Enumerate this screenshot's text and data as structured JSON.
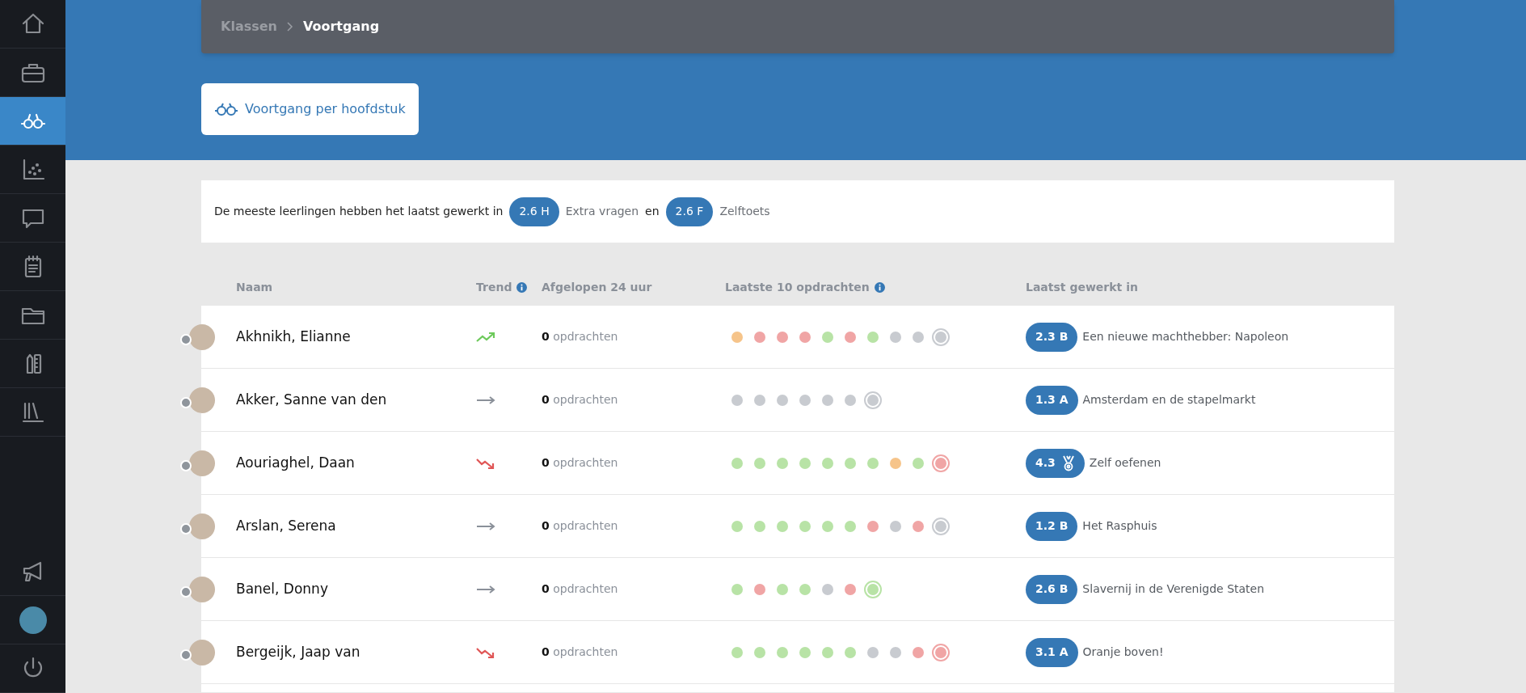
{
  "sidebar": {
    "items": [
      {
        "kind": "home",
        "selected": false
      },
      {
        "kind": "briefcase",
        "selected": false
      },
      {
        "kind": "glasses",
        "selected": true
      },
      {
        "kind": "scatter",
        "selected": false
      },
      {
        "kind": "chat",
        "selected": false
      },
      {
        "kind": "notepad",
        "selected": false
      },
      {
        "kind": "folder",
        "selected": false
      },
      {
        "kind": "tools",
        "selected": false
      },
      {
        "kind": "library",
        "selected": false
      }
    ],
    "bottom_items": [
      {
        "kind": "megaphone"
      },
      {
        "kind": "avatar"
      },
      {
        "kind": "power"
      }
    ]
  },
  "breadcrumb": [
    "Klassen",
    "Voortgang"
  ],
  "action_button": "Voortgang per hoofdstuk",
  "summary": {
    "lead": "De meeste leerlingen hebben het laatst gewerkt in",
    "badge_1": "2.6 H",
    "label_1": "Extra vragen",
    "joiner": "en",
    "badge_2": "2.6 F",
    "label_2": "Zelftoets"
  },
  "table": {
    "columns": [
      {
        "label": "Naam",
        "info": false
      },
      {
        "label": "Trend",
        "info": true
      },
      {
        "label": "Afgelopen 24 uur",
        "info": false
      },
      {
        "label": "Laatste 10 opdrachten",
        "info": true
      },
      {
        "label": "Laatst gewerkt in",
        "info": false
      }
    ],
    "rows": [
      {
        "name": "Akhnikh, Elianne",
        "trend": {
          "kind": "up"
        },
        "count": "0",
        "count_label": "opdrachten",
        "dots": [
          {
            "color": "#f6c48a"
          },
          {
            "color": "#f0a5a5"
          },
          {
            "color": "#f0a5a5"
          },
          {
            "color": "#f0a5a5"
          },
          {
            "color": "#b8e3a6"
          },
          {
            "color": "#f0a5a5"
          },
          {
            "color": "#b8e3a6"
          },
          {
            "color": "#c8cbd0"
          },
          {
            "color": "#c8cbd0"
          },
          {
            "color": "#c8cbd0"
          }
        ],
        "badge": "2.3 B",
        "medal": false,
        "chapter": "Een nieuwe machthebber: Napoleon"
      },
      {
        "name": "Akker, Sanne van den",
        "trend": {
          "kind": "flat"
        },
        "count": "0",
        "count_label": "opdrachten",
        "dots": [
          {
            "color": "#c8cbd0"
          },
          {
            "color": "#c8cbd0"
          },
          {
            "color": "#c8cbd0"
          },
          {
            "color": "#c8cbd0"
          },
          {
            "color": "#c8cbd0"
          },
          {
            "color": "#c8cbd0"
          },
          {
            "color": "#c8cbd0"
          }
        ],
        "badge": "1.3 A",
        "medal": false,
        "chapter": "Amsterdam en de stapelmarkt"
      },
      {
        "name": "Aouriaghel, Daan",
        "trend": {
          "kind": "down"
        },
        "count": "0",
        "count_label": "opdrachten",
        "dots": [
          {
            "color": "#b8e3a6"
          },
          {
            "color": "#b8e3a6"
          },
          {
            "color": "#b8e3a6"
          },
          {
            "color": "#b8e3a6"
          },
          {
            "color": "#b8e3a6"
          },
          {
            "color": "#b8e3a6"
          },
          {
            "color": "#b8e3a6"
          },
          {
            "color": "#f6c48a"
          },
          {
            "color": "#b8e3a6"
          },
          {
            "color": "#f0a5a5"
          }
        ],
        "badge": "4.3",
        "medal": true,
        "chapter": "Zelf oefenen"
      },
      {
        "name": "Arslan, Serena",
        "trend": {
          "kind": "flat"
        },
        "count": "0",
        "count_label": "opdrachten",
        "dots": [
          {
            "color": "#b8e3a6"
          },
          {
            "color": "#b8e3a6"
          },
          {
            "color": "#b8e3a6"
          },
          {
            "color": "#b8e3a6"
          },
          {
            "color": "#b8e3a6"
          },
          {
            "color": "#b8e3a6"
          },
          {
            "color": "#f0a5a5"
          },
          {
            "color": "#c8cbd0"
          },
          {
            "color": "#f0a5a5"
          },
          {
            "color": "#c8cbd0"
          }
        ],
        "badge": "1.2 B",
        "medal": false,
        "chapter": "Het Rasphuis"
      },
      {
        "name": "Banel, Donny",
        "trend": {
          "kind": "flat"
        },
        "count": "0",
        "count_label": "opdrachten",
        "dots": [
          {
            "color": "#b8e3a6"
          },
          {
            "color": "#f0a5a5"
          },
          {
            "color": "#b8e3a6"
          },
          {
            "color": "#b8e3a6"
          },
          {
            "color": "#c8cbd0"
          },
          {
            "color": "#f0a5a5"
          },
          {
            "color": "#b8e3a6"
          }
        ],
        "badge": "2.6 B",
        "medal": false,
        "chapter": "Slavernij in de Verenigde Staten"
      },
      {
        "name": "Bergeijk, Jaap van",
        "trend": {
          "kind": "down"
        },
        "count": "0",
        "count_label": "opdrachten",
        "dots": [
          {
            "color": "#b8e3a6"
          },
          {
            "color": "#b8e3a6"
          },
          {
            "color": "#b8e3a6"
          },
          {
            "color": "#b8e3a6"
          },
          {
            "color": "#b8e3a6"
          },
          {
            "color": "#b8e3a6"
          },
          {
            "color": "#c8cbd0"
          },
          {
            "color": "#c8cbd0"
          },
          {
            "color": "#f0a5a5"
          },
          {
            "color": "#f0a5a5"
          }
        ],
        "badge": "3.1 A",
        "medal": false,
        "chapter": "Oranje boven!"
      }
    ]
  }
}
